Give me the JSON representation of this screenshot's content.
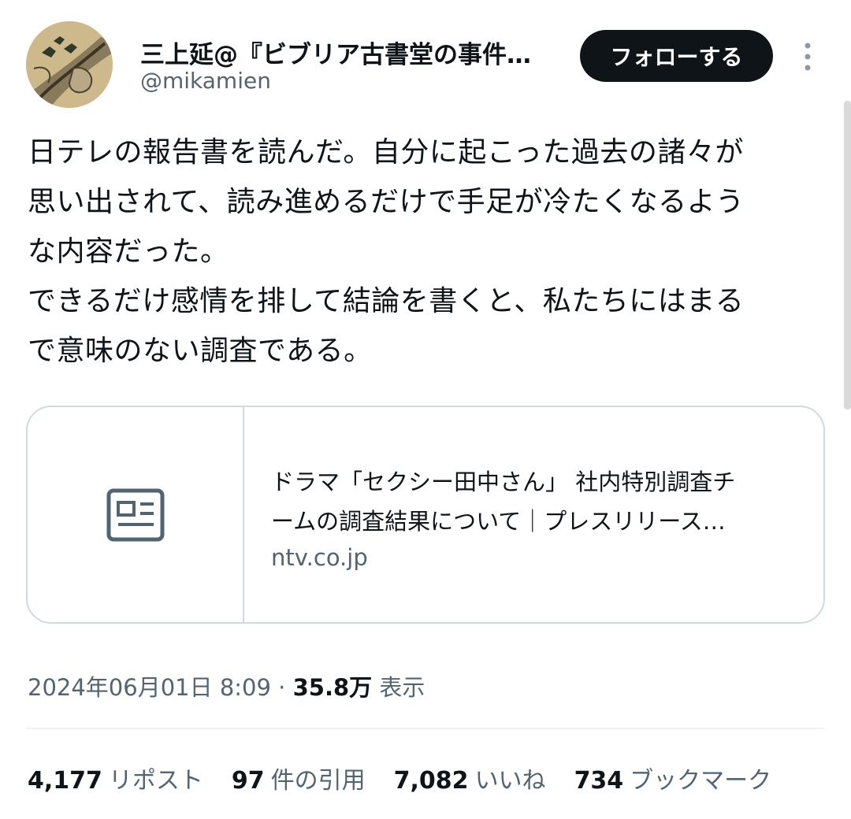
{
  "author": {
    "name": "三上延@『ビブリア古書堂の事件…",
    "handle": "@mikamien"
  },
  "follow_label": "フォローする",
  "tweet_lines": [
    "日テレの報告書を読んだ。自分に起こった過去の諸々が",
    "思い出されて、読み進めるだけで手足が冷たくなるよう",
    "な内容だった。",
    "できるだけ感情を排して結論を書くと、私たちにはまる",
    "で意味のない調査である。"
  ],
  "card": {
    "title_line1": "ドラマ「セクシー田中さん」 社内特別調査チ",
    "title_line2": "ームの調査結果について｜プレスリリース…",
    "domain": "ntv.co.jp",
    "thumb_icon": "article-icon"
  },
  "meta": {
    "timestamp": "2024年06月01日 8:09",
    "separator": " · ",
    "views_count": "35.8万",
    "views_label": "表示"
  },
  "stats": {
    "reposts": {
      "count": "4,177",
      "label": "リポスト"
    },
    "quotes": {
      "count": "97",
      "label": "件の引用"
    },
    "likes": {
      "count": "7,082",
      "label": "いいね"
    },
    "bookmarks": {
      "count": "734",
      "label": "ブックマーク"
    }
  },
  "colors": {
    "text": "#0f1419",
    "secondary": "#536471",
    "border": "#cfd9de",
    "follow_bg": "#0f1419"
  }
}
